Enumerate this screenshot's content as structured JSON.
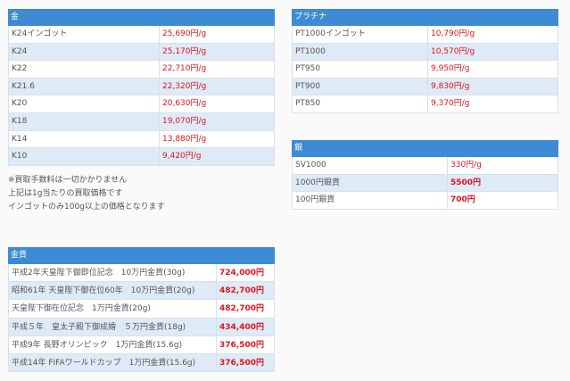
{
  "gold": {
    "title": "金",
    "rows": [
      {
        "name": "K24インゴット",
        "price": "25,690円/g"
      },
      {
        "name": "K24",
        "price": "25,170円/g"
      },
      {
        "name": "K22",
        "price": "22,710円/g"
      },
      {
        "name": "K21.6",
        "price": "22,320円/g"
      },
      {
        "name": "K20",
        "price": "20,630円/g"
      },
      {
        "name": "K18",
        "price": "19,070円/g"
      },
      {
        "name": "K14",
        "price": "13,880円/g"
      },
      {
        "name": "K10",
        "price": "9,420円/g"
      }
    ]
  },
  "notes": [
    "※買取手数料は一切かかりません",
    "上記は1g当たりの買取価格です",
    "インゴットのみ100g以上の価格となります"
  ],
  "platinum": {
    "title": "プラチナ",
    "rows": [
      {
        "name": "PT1000インゴット",
        "price": "10,790円/g"
      },
      {
        "name": "PT1000",
        "price": "10,570円/g"
      },
      {
        "name": "PT950",
        "price": "9,950円/g"
      },
      {
        "name": "PT900",
        "price": "9,830円/g"
      },
      {
        "name": "PT850",
        "price": "9,370円/g"
      }
    ]
  },
  "silver": {
    "title": "銀",
    "rows": [
      {
        "name": "SV1000",
        "price": "330円/g"
      },
      {
        "name": "1000円銀貨",
        "price": "5500円"
      },
      {
        "name": "100円銀貨",
        "price": "700円"
      }
    ]
  },
  "coins": {
    "title": "金貨",
    "rows": [
      {
        "name": "平成2年天皇陛下御即位記念　10万円金貨(30g)",
        "price": "724,000円"
      },
      {
        "name": "昭和61年 天皇陛下御在位60年　10万円金貨(20g)",
        "price": "482,700円"
      },
      {
        "name": "天皇陛下御在位記念　1万円金貨(20g)",
        "price": "482,700円"
      },
      {
        "name": "平成５年　皇太子殿下御成婚　５万円金貨(18g)",
        "price": "434,400円"
      },
      {
        "name": "平成9年 長野オリンピック　1万円金貨(15.6g)",
        "price": "376,500円"
      },
      {
        "name": "平成14年 FIFAワールドカップ　1万円金貨(15.6g)",
        "price": "376,500円"
      }
    ]
  }
}
